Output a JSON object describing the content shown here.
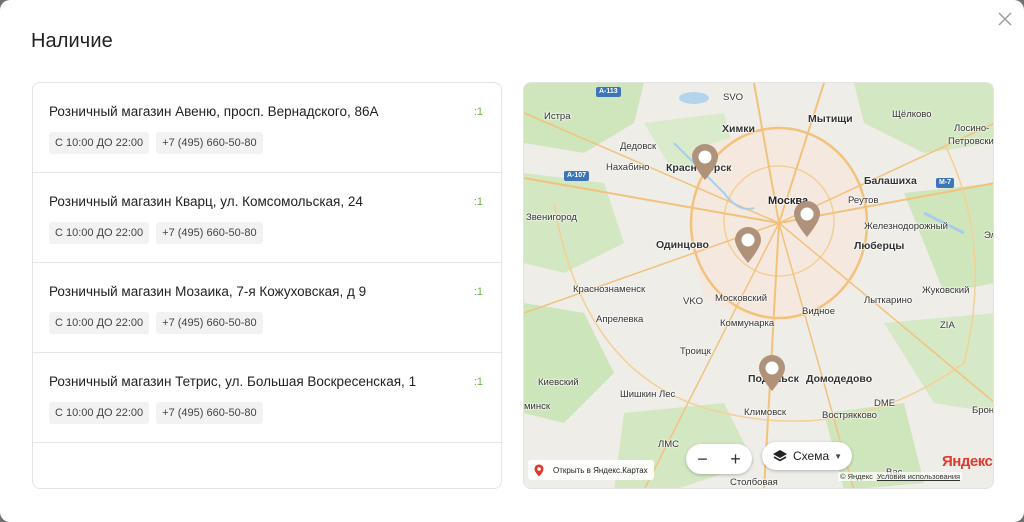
{
  "modal": {
    "title": "Наличие"
  },
  "stores": [
    {
      "name": "Розничный магазин Авеню, просп. Вернадского, 86А",
      "qty": ":1",
      "hours": "С 10:00 ДО 22:00",
      "phone": "+7 (495) 660-50-80"
    },
    {
      "name": "Розничный магазин Кварц, ул. Комсомольская, 24",
      "qty": ":1",
      "hours": "С 10:00 ДО 22:00",
      "phone": "+7 (495) 660-50-80"
    },
    {
      "name": "Розничный магазин Мозаика, 7-я Кожуховская, д 9",
      "qty": ":1",
      "hours": "С 10:00 ДО 22:00",
      "phone": "+7 (495) 660-50-80"
    },
    {
      "name": "Розничный магазин Тетрис, ул. Большая Воскресенская, 1",
      "qty": ":1",
      "hours": "С 10:00 ДО 22:00",
      "phone": "+7 (495) 660-50-80"
    }
  ],
  "map": {
    "labels": {
      "istra": "Истра",
      "dedovsk": "Дедовск",
      "nakhabino": "Нахабино",
      "krasnogorsk": "Красногорск",
      "khimki": "Химки",
      "mytishchi": "Мытищи",
      "shchelkovo": "Щёлково",
      "losino": "Лосино-",
      "petrovsky": "Петровский",
      "svo": "SVO",
      "zvenigorod": "Звенигород",
      "moskva": "Москва",
      "balashikha": "Балашиха",
      "reutov": "Реутов",
      "zheleznodorozhny": "Железнодорожный",
      "odintsovo": "Одинцово",
      "lyubertsy": "Люберцы",
      "krasnoznamensk": "Краснознаменск",
      "vko": "VKO",
      "moskovsky": "Московский",
      "lytkarino": "Лыткарино",
      "zhukovsky": "Жуковский",
      "aprelevka": "Апрелевка",
      "vidnoe": "Видное",
      "kommunarka": "Коммунарка",
      "zia": "ZIA",
      "troitsk": "Троицк",
      "podolsk": "Подольск",
      "domodedovo": "Домодедово",
      "kievsky": "Киевский",
      "shishkin_les": "Шишкин Лес",
      "dme": "DME",
      "minsk": "минск",
      "klimovsk": "Климовск",
      "voskresenskoe": "Вострякково",
      "bron": "Брон",
      "lms": "ЛМС",
      "vas": "Вас",
      "stolbovaya": "Столбовая",
      "el": "Эл",
      "a113": "А-113",
      "a107": "А-107",
      "m7": "М-7"
    },
    "zoom_out": "−",
    "zoom_in": "+",
    "scheme_label": "Схема",
    "open_maps": "Открыть в Яндекс.Картах",
    "logo": "Яндекс",
    "copyright": "© Яндекс",
    "terms": "Условия использования"
  },
  "colors": {
    "qty_green": "#6bb544",
    "pin_brown": "#b0927a",
    "yandex_red": "#e03a2f"
  }
}
